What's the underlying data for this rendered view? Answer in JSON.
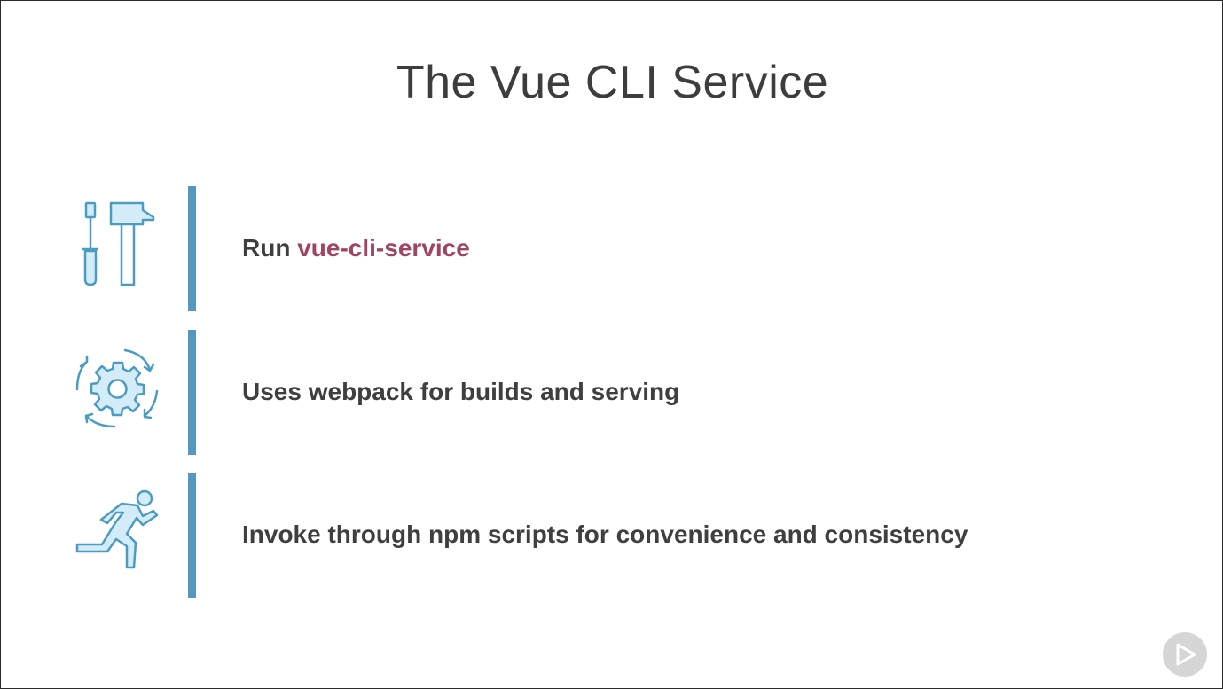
{
  "slide": {
    "title": "The Vue CLI Service"
  },
  "points": [
    {
      "icon": "tools-icon",
      "text_prefix": "Run ",
      "text_accent": "vue-cli-service"
    },
    {
      "icon": "gear-cycle-icon",
      "text": "Uses webpack for builds and serving"
    },
    {
      "icon": "runner-icon",
      "text": "Invoke through npm scripts for convenience and consistency"
    }
  ],
  "colors": {
    "accent_bar": "#5498bd",
    "icon_stroke": "#4a9cc1",
    "icon_fill": "#d3ecf7",
    "highlight_text": "#a0445f",
    "body_text": "#3f3f3f"
  },
  "player": {
    "icon": "play-icon"
  }
}
